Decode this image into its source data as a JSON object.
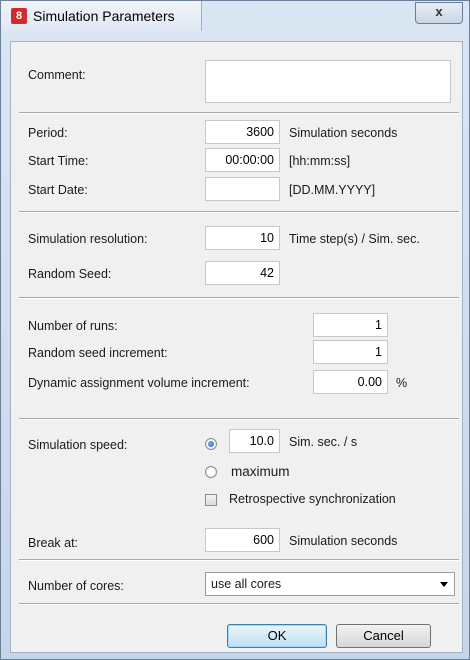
{
  "window": {
    "title": "Simulation Parameters",
    "close_label": "x",
    "app_icon_glyph": "8"
  },
  "comment": {
    "label": "Comment:",
    "value": ""
  },
  "period": {
    "label": "Period:",
    "value": "3600",
    "unit": "Simulation seconds"
  },
  "start_time": {
    "label": "Start Time:",
    "value": "00:00:00",
    "unit": "[hh:mm:ss]"
  },
  "start_date": {
    "label": "Start Date:",
    "value": "",
    "unit": "[DD.MM.YYYY]"
  },
  "resolution": {
    "label": "Simulation resolution:",
    "value": "10",
    "unit": "Time step(s) / Sim. sec."
  },
  "random_seed": {
    "label": "Random Seed:",
    "value": "42"
  },
  "number_of_runs": {
    "label": "Number of runs:",
    "value": "1"
  },
  "seed_increment": {
    "label": "Random seed increment:",
    "value": "1"
  },
  "dynamic_volume": {
    "label": "Dynamic assignment volume increment:",
    "value": "0.00",
    "unit": "%"
  },
  "speed": {
    "label": "Simulation speed:",
    "value": "10.0",
    "unit": "Sim. sec. / s",
    "maximum_label": "maximum",
    "selected": "value"
  },
  "retrospective": {
    "label": "Retrospective synchronization",
    "checked": false
  },
  "break_at": {
    "label": "Break at:",
    "value": "600",
    "unit": "Simulation seconds"
  },
  "cores": {
    "label": "Number of cores:",
    "selected": "use all cores"
  },
  "buttons": {
    "ok": "OK",
    "cancel": "Cancel"
  },
  "colors": {
    "accent": "#3c7fb1",
    "app_icon": "#d42a2a"
  }
}
